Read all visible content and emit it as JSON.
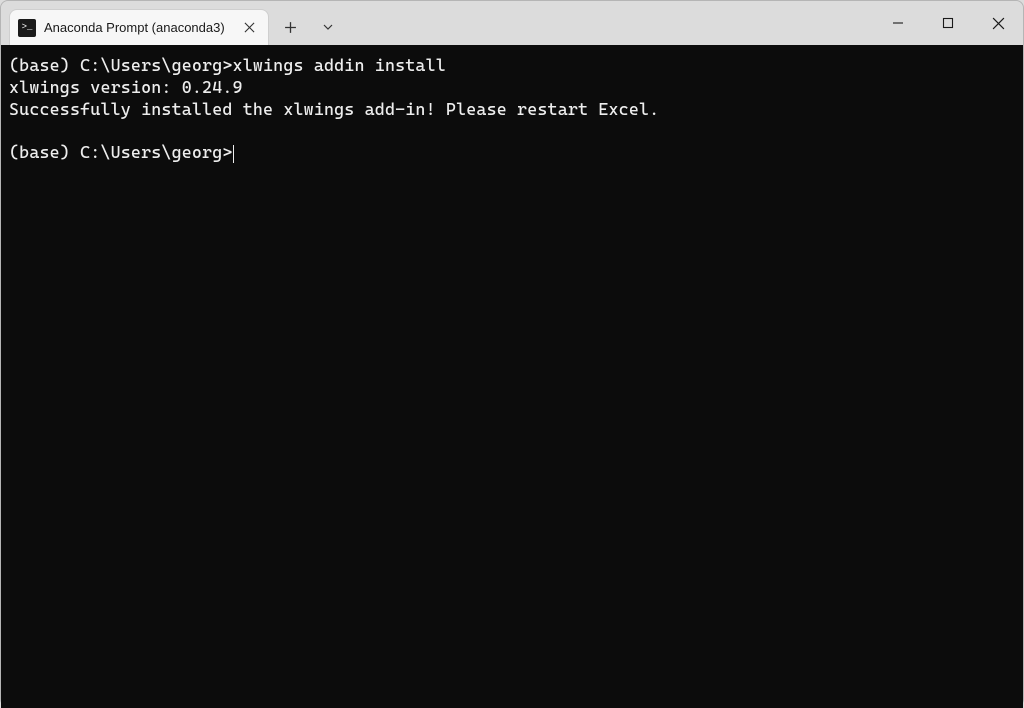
{
  "window": {
    "tab_title": "Anaconda Prompt (anaconda3)",
    "tab_icon_text": ">_"
  },
  "terminal": {
    "lines": [
      "(base) C:\\Users\\georg>xlwings addin install",
      "xlwings version: 0.24.9",
      "Successfully installed the xlwings add-in! Please restart Excel.",
      "",
      "(base) C:\\Users\\georg>"
    ]
  }
}
